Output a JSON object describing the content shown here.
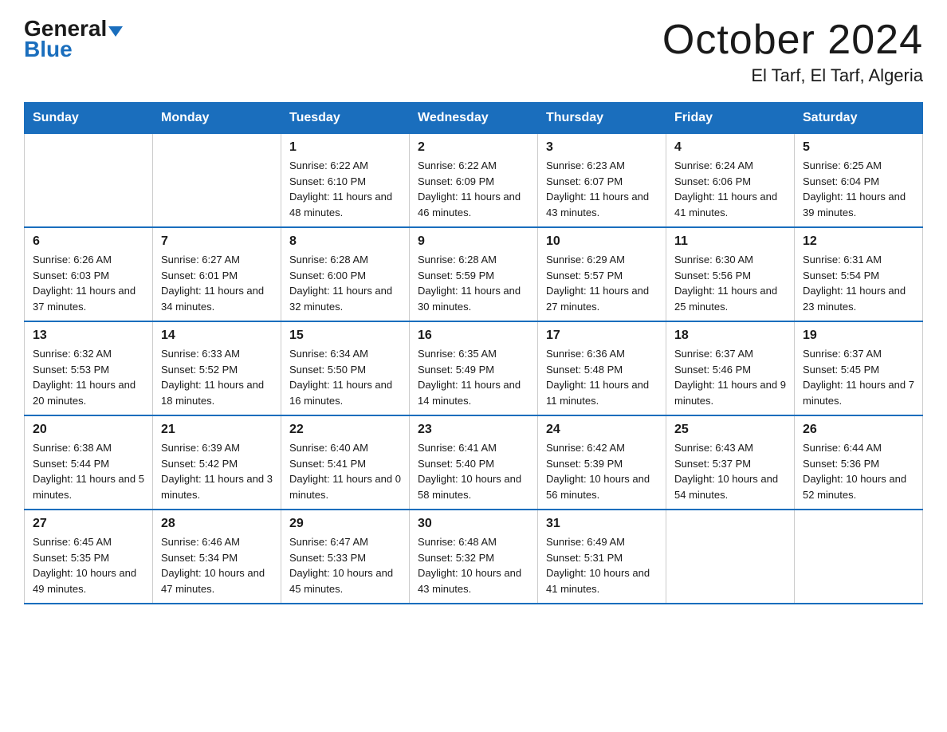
{
  "header": {
    "logo": {
      "line1": "General",
      "triangle": "▶",
      "line2": "Blue"
    },
    "title": "October 2024",
    "location": "El Tarf, El Tarf, Algeria"
  },
  "days_of_week": [
    "Sunday",
    "Monday",
    "Tuesday",
    "Wednesday",
    "Thursday",
    "Friday",
    "Saturday"
  ],
  "weeks": [
    [
      {
        "day": "",
        "sunrise": "",
        "sunset": "",
        "daylight": ""
      },
      {
        "day": "",
        "sunrise": "",
        "sunset": "",
        "daylight": ""
      },
      {
        "day": "1",
        "sunrise": "Sunrise: 6:22 AM",
        "sunset": "Sunset: 6:10 PM",
        "daylight": "Daylight: 11 hours and 48 minutes."
      },
      {
        "day": "2",
        "sunrise": "Sunrise: 6:22 AM",
        "sunset": "Sunset: 6:09 PM",
        "daylight": "Daylight: 11 hours and 46 minutes."
      },
      {
        "day": "3",
        "sunrise": "Sunrise: 6:23 AM",
        "sunset": "Sunset: 6:07 PM",
        "daylight": "Daylight: 11 hours and 43 minutes."
      },
      {
        "day": "4",
        "sunrise": "Sunrise: 6:24 AM",
        "sunset": "Sunset: 6:06 PM",
        "daylight": "Daylight: 11 hours and 41 minutes."
      },
      {
        "day": "5",
        "sunrise": "Sunrise: 6:25 AM",
        "sunset": "Sunset: 6:04 PM",
        "daylight": "Daylight: 11 hours and 39 minutes."
      }
    ],
    [
      {
        "day": "6",
        "sunrise": "Sunrise: 6:26 AM",
        "sunset": "Sunset: 6:03 PM",
        "daylight": "Daylight: 11 hours and 37 minutes."
      },
      {
        "day": "7",
        "sunrise": "Sunrise: 6:27 AM",
        "sunset": "Sunset: 6:01 PM",
        "daylight": "Daylight: 11 hours and 34 minutes."
      },
      {
        "day": "8",
        "sunrise": "Sunrise: 6:28 AM",
        "sunset": "Sunset: 6:00 PM",
        "daylight": "Daylight: 11 hours and 32 minutes."
      },
      {
        "day": "9",
        "sunrise": "Sunrise: 6:28 AM",
        "sunset": "Sunset: 5:59 PM",
        "daylight": "Daylight: 11 hours and 30 minutes."
      },
      {
        "day": "10",
        "sunrise": "Sunrise: 6:29 AM",
        "sunset": "Sunset: 5:57 PM",
        "daylight": "Daylight: 11 hours and 27 minutes."
      },
      {
        "day": "11",
        "sunrise": "Sunrise: 6:30 AM",
        "sunset": "Sunset: 5:56 PM",
        "daylight": "Daylight: 11 hours and 25 minutes."
      },
      {
        "day": "12",
        "sunrise": "Sunrise: 6:31 AM",
        "sunset": "Sunset: 5:54 PM",
        "daylight": "Daylight: 11 hours and 23 minutes."
      }
    ],
    [
      {
        "day": "13",
        "sunrise": "Sunrise: 6:32 AM",
        "sunset": "Sunset: 5:53 PM",
        "daylight": "Daylight: 11 hours and 20 minutes."
      },
      {
        "day": "14",
        "sunrise": "Sunrise: 6:33 AM",
        "sunset": "Sunset: 5:52 PM",
        "daylight": "Daylight: 11 hours and 18 minutes."
      },
      {
        "day": "15",
        "sunrise": "Sunrise: 6:34 AM",
        "sunset": "Sunset: 5:50 PM",
        "daylight": "Daylight: 11 hours and 16 minutes."
      },
      {
        "day": "16",
        "sunrise": "Sunrise: 6:35 AM",
        "sunset": "Sunset: 5:49 PM",
        "daylight": "Daylight: 11 hours and 14 minutes."
      },
      {
        "day": "17",
        "sunrise": "Sunrise: 6:36 AM",
        "sunset": "Sunset: 5:48 PM",
        "daylight": "Daylight: 11 hours and 11 minutes."
      },
      {
        "day": "18",
        "sunrise": "Sunrise: 6:37 AM",
        "sunset": "Sunset: 5:46 PM",
        "daylight": "Daylight: 11 hours and 9 minutes."
      },
      {
        "day": "19",
        "sunrise": "Sunrise: 6:37 AM",
        "sunset": "Sunset: 5:45 PM",
        "daylight": "Daylight: 11 hours and 7 minutes."
      }
    ],
    [
      {
        "day": "20",
        "sunrise": "Sunrise: 6:38 AM",
        "sunset": "Sunset: 5:44 PM",
        "daylight": "Daylight: 11 hours and 5 minutes."
      },
      {
        "day": "21",
        "sunrise": "Sunrise: 6:39 AM",
        "sunset": "Sunset: 5:42 PM",
        "daylight": "Daylight: 11 hours and 3 minutes."
      },
      {
        "day": "22",
        "sunrise": "Sunrise: 6:40 AM",
        "sunset": "Sunset: 5:41 PM",
        "daylight": "Daylight: 11 hours and 0 minutes."
      },
      {
        "day": "23",
        "sunrise": "Sunrise: 6:41 AM",
        "sunset": "Sunset: 5:40 PM",
        "daylight": "Daylight: 10 hours and 58 minutes."
      },
      {
        "day": "24",
        "sunrise": "Sunrise: 6:42 AM",
        "sunset": "Sunset: 5:39 PM",
        "daylight": "Daylight: 10 hours and 56 minutes."
      },
      {
        "day": "25",
        "sunrise": "Sunrise: 6:43 AM",
        "sunset": "Sunset: 5:37 PM",
        "daylight": "Daylight: 10 hours and 54 minutes."
      },
      {
        "day": "26",
        "sunrise": "Sunrise: 6:44 AM",
        "sunset": "Sunset: 5:36 PM",
        "daylight": "Daylight: 10 hours and 52 minutes."
      }
    ],
    [
      {
        "day": "27",
        "sunrise": "Sunrise: 6:45 AM",
        "sunset": "Sunset: 5:35 PM",
        "daylight": "Daylight: 10 hours and 49 minutes."
      },
      {
        "day": "28",
        "sunrise": "Sunrise: 6:46 AM",
        "sunset": "Sunset: 5:34 PM",
        "daylight": "Daylight: 10 hours and 47 minutes."
      },
      {
        "day": "29",
        "sunrise": "Sunrise: 6:47 AM",
        "sunset": "Sunset: 5:33 PM",
        "daylight": "Daylight: 10 hours and 45 minutes."
      },
      {
        "day": "30",
        "sunrise": "Sunrise: 6:48 AM",
        "sunset": "Sunset: 5:32 PM",
        "daylight": "Daylight: 10 hours and 43 minutes."
      },
      {
        "day": "31",
        "sunrise": "Sunrise: 6:49 AM",
        "sunset": "Sunset: 5:31 PM",
        "daylight": "Daylight: 10 hours and 41 minutes."
      },
      {
        "day": "",
        "sunrise": "",
        "sunset": "",
        "daylight": ""
      },
      {
        "day": "",
        "sunrise": "",
        "sunset": "",
        "daylight": ""
      }
    ]
  ]
}
